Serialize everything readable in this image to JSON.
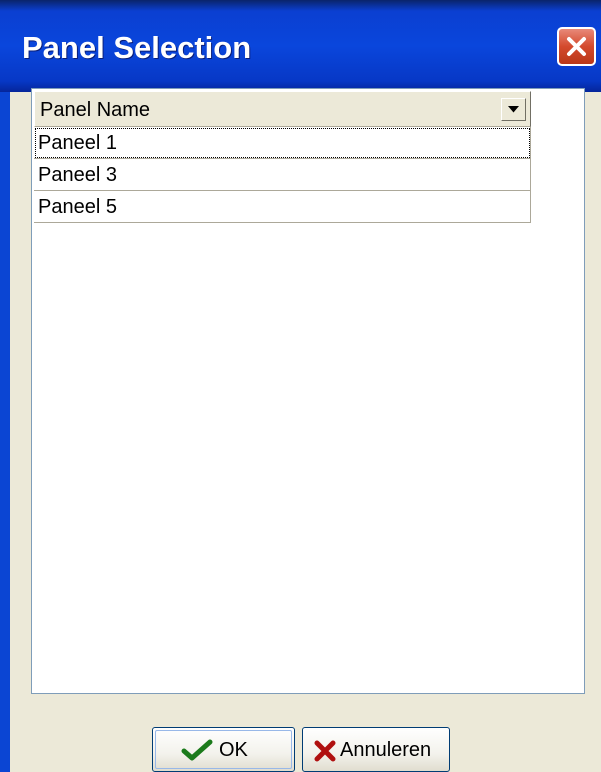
{
  "window": {
    "title": "Panel Selection"
  },
  "grid": {
    "column_header": "Panel Name",
    "rows": [
      "Paneel 1",
      "Paneel 3",
      "Paneel 5"
    ],
    "selected_row": "Paneel 1"
  },
  "buttons": {
    "ok_label": "OK",
    "cancel_label": "Annuleren"
  },
  "icons": {
    "close": "close-icon",
    "dropdown": "dropdown-arrow-icon",
    "ok": "checkmark-icon",
    "cancel": "cross-icon"
  },
  "colors": {
    "titlebar": "#0a46dc",
    "close_button": "#d44a2d",
    "window_face": "#ece9d8",
    "ok_check": "#1b7a1b",
    "cancel_cross": "#b01010"
  }
}
